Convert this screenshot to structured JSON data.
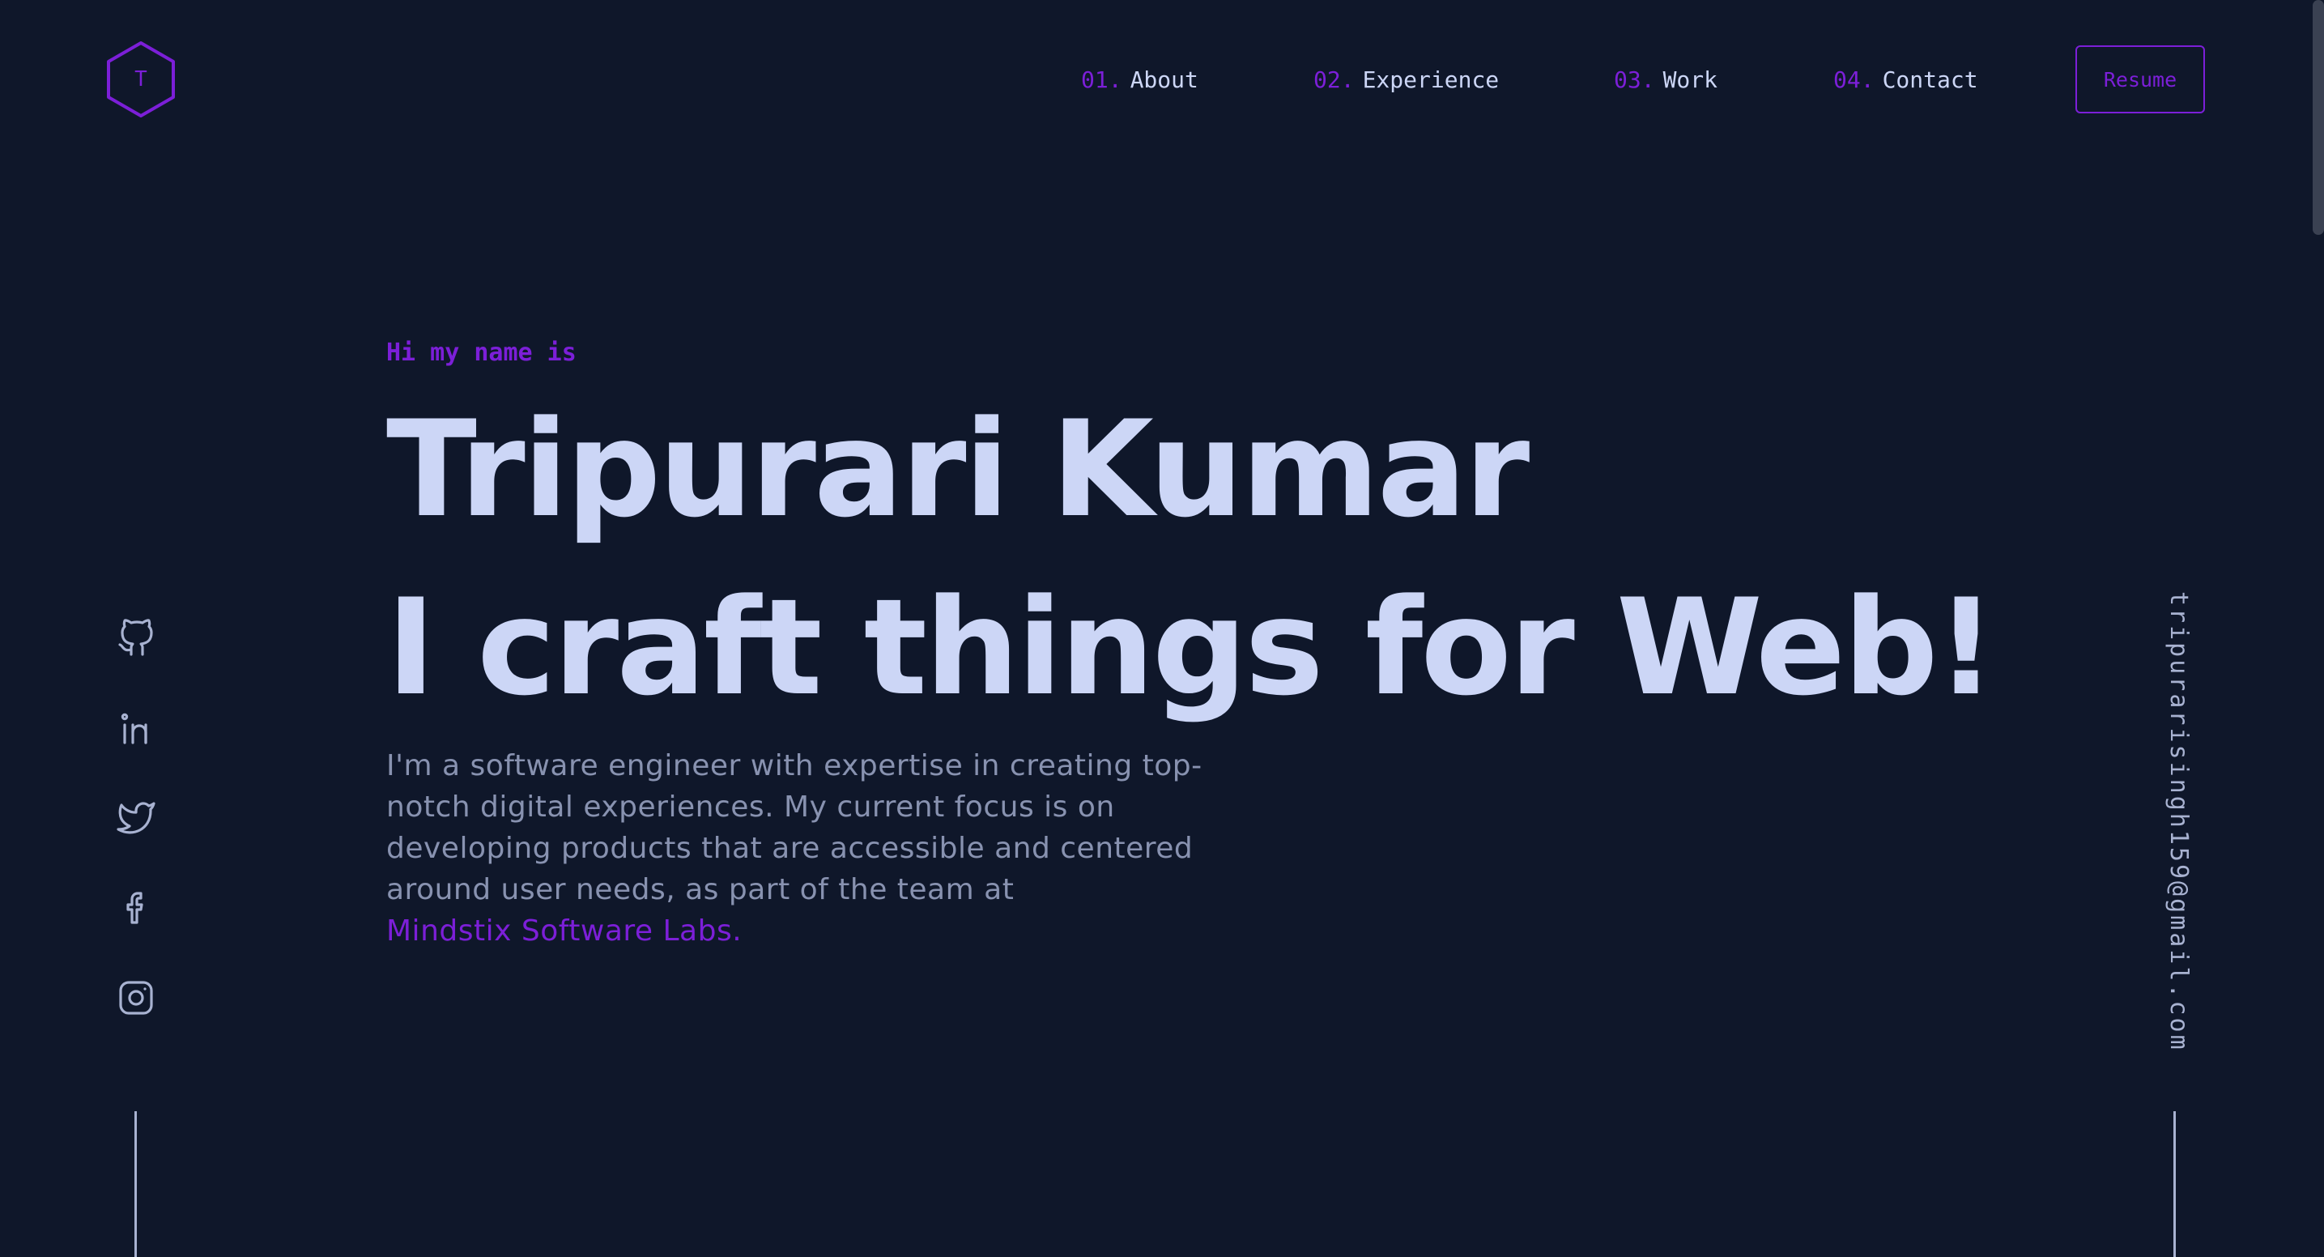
{
  "logo": {
    "letter": "T",
    "icon": "hexagon-logo-icon"
  },
  "nav": {
    "items": [
      {
        "number": "01.",
        "label": "About"
      },
      {
        "number": "02.",
        "label": "Experience"
      },
      {
        "number": "03.",
        "label": "Work"
      },
      {
        "number": "04.",
        "label": "Contact"
      }
    ],
    "resume_label": "Resume"
  },
  "hero": {
    "greeting": "Hi my name is",
    "name": "Tripurari Kumar",
    "tagline": "I craft things for Web!",
    "bio": "I'm a software engineer with expertise in creating top-notch digital experiences. My current focus is on developing products that are accessible and centered around user needs, as part of the team at",
    "company": "Mindstix Software Labs."
  },
  "socials": [
    {
      "icon": "github-icon"
    },
    {
      "icon": "linkedin-icon"
    },
    {
      "icon": "twitter-icon"
    },
    {
      "icon": "facebook-icon"
    },
    {
      "icon": "instagram-icon"
    }
  ],
  "email": "tripurarisingh159@gmail.com",
  "colors": {
    "background": "#0f172a",
    "accent": "#7c1fd8",
    "heading": "#ccd6f6",
    "body_text": "#8892b0",
    "line": "#a8b2d1"
  }
}
